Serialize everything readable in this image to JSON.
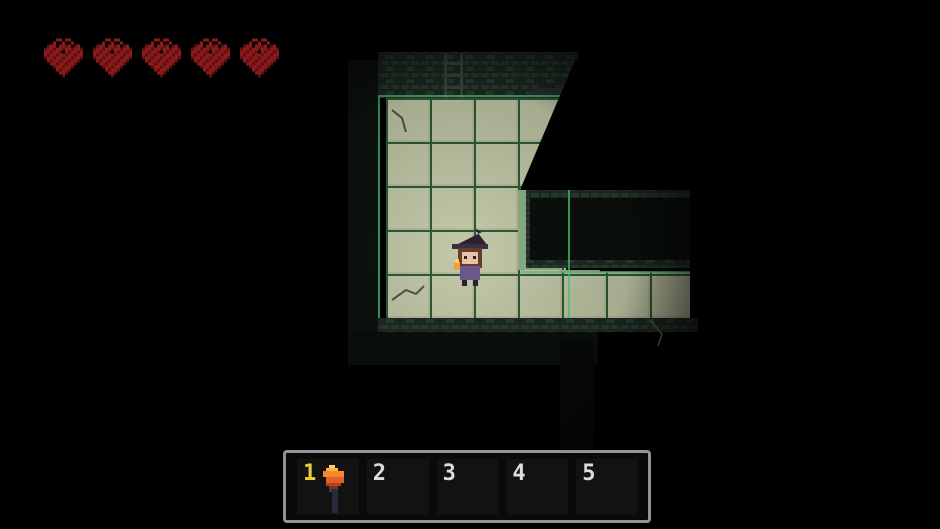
{
  "hud": {
    "hearts": [
      {
        "icon": "heart-icon",
        "filled": true
      },
      {
        "icon": "heart-icon",
        "filled": true
      },
      {
        "icon": "heart-icon",
        "filled": true
      },
      {
        "icon": "heart-icon",
        "filled": true
      },
      {
        "icon": "heart-icon",
        "filled": true
      }
    ],
    "heart_color": "#8b1a1a"
  },
  "hotbar": {
    "selected_index": 0,
    "slots": [
      {
        "number": "1",
        "item": "torch-icon"
      },
      {
        "number": "2",
        "item": ""
      },
      {
        "number": "3",
        "item": ""
      },
      {
        "number": "4",
        "item": ""
      },
      {
        "number": "5",
        "item": ""
      }
    ],
    "border_color": "#8e9499",
    "selected_number_color": "#e8cf3a"
  },
  "scene": {
    "player": "witch-character",
    "floor_color": "#a9b393",
    "wall_glow_color": "#4fd37a"
  }
}
